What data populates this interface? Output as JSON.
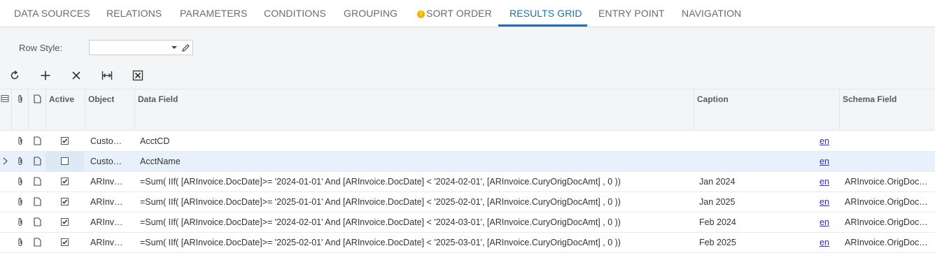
{
  "tabs": [
    {
      "label": "DATA SOURCES"
    },
    {
      "label": "RELATIONS"
    },
    {
      "label": "PARAMETERS"
    },
    {
      "label": "CONDITIONS"
    },
    {
      "label": "GROUPING"
    },
    {
      "label": "SORT ORDER",
      "warning": true
    },
    {
      "label": "RESULTS GRID",
      "active": true
    },
    {
      "label": "ENTRY POINT"
    },
    {
      "label": "NAVIGATION"
    }
  ],
  "form": {
    "row_style_label": "Row Style:",
    "row_style_value": ""
  },
  "toolbar": [
    "refresh-icon",
    "add-icon",
    "delete-icon",
    "fit-columns-icon",
    "export-excel-icon"
  ],
  "grid": {
    "columns": {
      "active": "Active",
      "object": "Object",
      "data_field": "Data Field",
      "caption": "Caption",
      "schema_field": "Schema Field"
    },
    "rows": [
      {
        "active": true,
        "object": "Custo…",
        "data_field": "AcctCD",
        "caption": "",
        "lang": "en",
        "schema_field": ""
      },
      {
        "active": false,
        "object": "Custo…",
        "data_field": "AcctName",
        "caption": "",
        "lang": "en",
        "schema_field": "",
        "selected": true
      },
      {
        "active": true,
        "object": "ARInv…",
        "data_field": "=Sum( IIf( [ARInvoice.DocDate]>= '2024-01-01' And [ARInvoice.DocDate] < '2024-02-01', [ARInvoice.CuryOrigDocAmt] , 0 ))",
        "caption": "Jan 2024",
        "lang": "en",
        "schema_field": "ARInvoice.OrigDoc…"
      },
      {
        "active": true,
        "object": "ARInv…",
        "data_field": "=Sum( IIf( [ARInvoice.DocDate]>= '2025-01-01' And [ARInvoice.DocDate] < '2025-02-01', [ARInvoice.CuryOrigDocAmt] , 0 ))",
        "caption": "Jan 2025",
        "lang": "en",
        "schema_field": "ARInvoice.OrigDoc…"
      },
      {
        "active": true,
        "object": "ARInv…",
        "data_field": "=Sum( IIf( [ARInvoice.DocDate]>= '2024-02-01' And [ARInvoice.DocDate] < '2024-03-01', [ARInvoice.CuryOrigDocAmt] , 0 ))",
        "caption": "Feb 2024",
        "lang": "en",
        "schema_field": "ARInvoice.OrigDoc…"
      },
      {
        "active": true,
        "object": "ARInv…",
        "data_field": "=Sum( IIf( [ARInvoice.DocDate]>= '2025-02-01' And [ARInvoice.DocDate] < '2025-03-01', [ARInvoice.CuryOrigDocAmt] , 0 ))",
        "caption": "Feb 2025",
        "lang": "en",
        "schema_field": "ARInvoice.OrigDoc…"
      }
    ]
  }
}
